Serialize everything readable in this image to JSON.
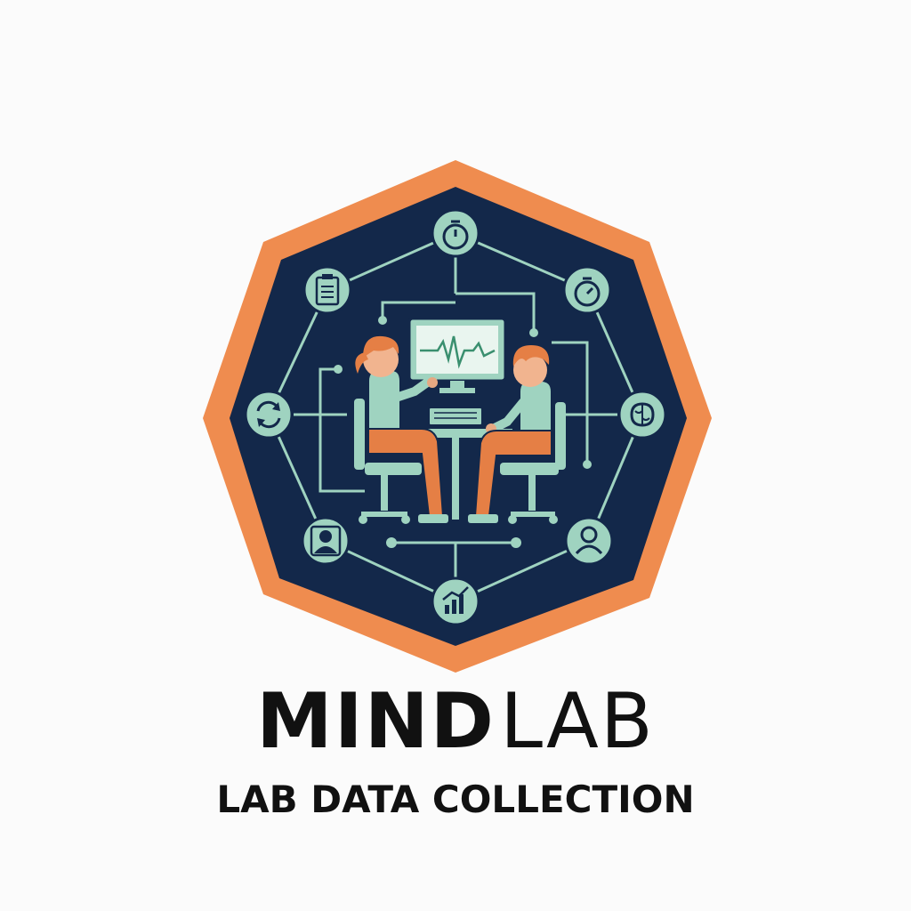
{
  "brand": {
    "name_bold": "MIND",
    "name_light": "LAB",
    "tagline": "LAB DATA COLLECTION"
  },
  "colors": {
    "background": "#fbfbfb",
    "border": "#ef8c4f",
    "panel": "#13284a",
    "mint": "#9fd3c0",
    "orange": "#e57f45",
    "text": "#111111"
  },
  "icons": [
    "timer-icon",
    "stopwatch-icon",
    "brain-icon",
    "user-icon",
    "growth-chart-icon",
    "participant-icon",
    "refresh-icon",
    "clipboard-icon"
  ]
}
